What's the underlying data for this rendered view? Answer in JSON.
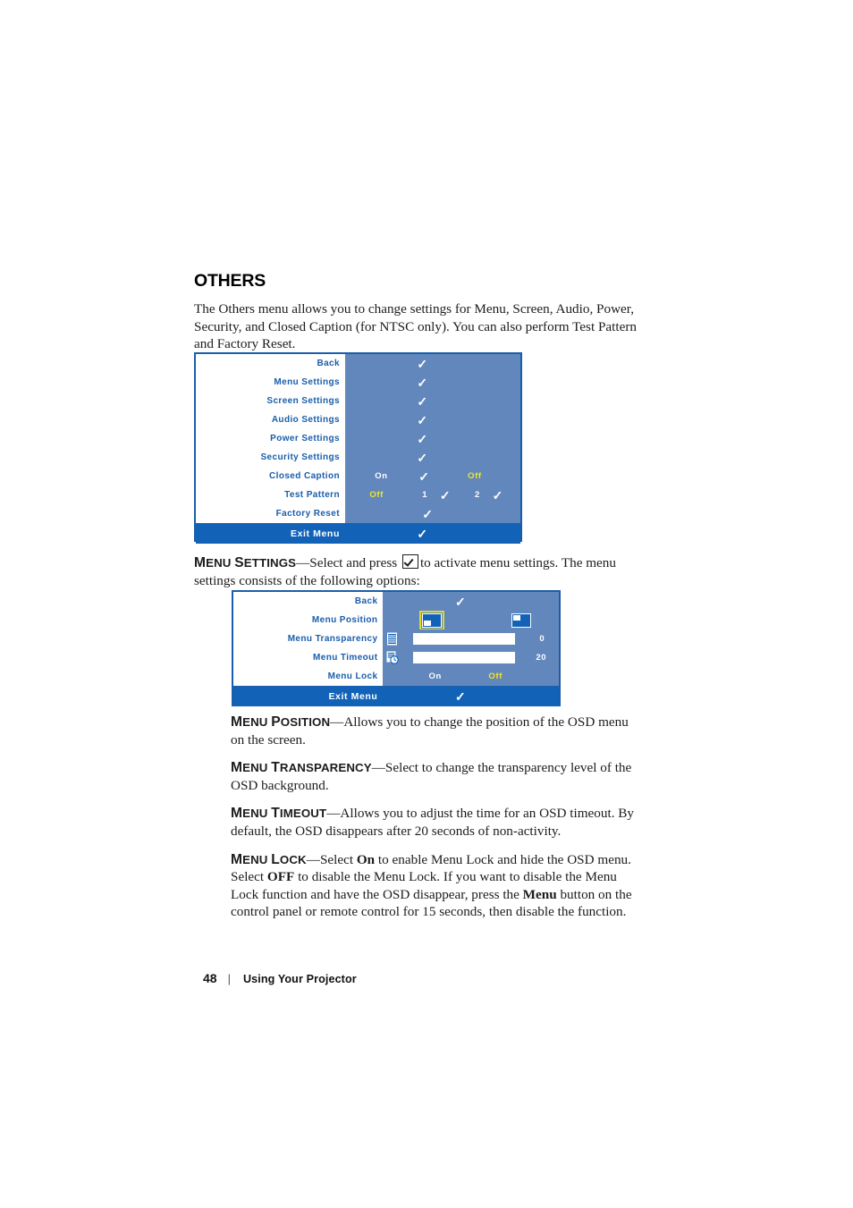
{
  "page": {
    "number": "48",
    "separator": "|",
    "chapter": "Using Your Projector"
  },
  "section": {
    "title": "OTHERS",
    "intro": "The Others menu allows you to change settings for Menu, Screen, Audio, Power, Security, and Closed Caption (for NTSC only). You can also perform Test Pattern and Factory Reset."
  },
  "osd_others": {
    "rows": [
      {
        "label": "Back",
        "check": "✓"
      },
      {
        "label": "Menu Settings",
        "check": "✓"
      },
      {
        "label": "Screen Settings",
        "check": "✓"
      },
      {
        "label": "Audio Settings",
        "check": "✓"
      },
      {
        "label": "Power Settings",
        "check": "✓"
      },
      {
        "label": "Security Settings",
        "check": "✓"
      },
      {
        "label": "Closed Caption",
        "opt1": "On",
        "opt1_check": "✓",
        "opt2": "Off"
      },
      {
        "label": "Test Pattern",
        "opt1": "Off",
        "opt2": "1",
        "opt2_check": "✓",
        "opt3": "2",
        "opt3_check": "✓"
      },
      {
        "label": "Factory Reset",
        "check": "✓"
      }
    ],
    "exit_label": "Exit Menu",
    "exit_check": "✓",
    "colors": {
      "panel_background": "#6287bc",
      "label_background": "#ffffff",
      "label_text": "#1a5eab",
      "exit_bar": "#1263b8",
      "border": "#1a5eab",
      "selected_option": "#f2e71d"
    }
  },
  "menu_settings_intro": {
    "term": "Menu Settings",
    "term_cap": "M",
    "term_cap2": "S",
    "text_before": "—Select and press",
    "icon": "enter-key-icon",
    "text_after": "to activate menu settings. The menu settings consists of the following options:"
  },
  "osd_menu_settings": {
    "rows": [
      {
        "label": "Back",
        "check": "✓"
      },
      {
        "label": "Menu Position",
        "icon1": "position-bottom-left-icon",
        "icon1_selected": true,
        "icon2": "position-top-left-icon"
      },
      {
        "label": "Menu Transparency",
        "glyph": "transparency-icon",
        "slider_percent": 50,
        "value": "0"
      },
      {
        "label": "Menu Timeout",
        "glyph": "timeout-clock-icon",
        "slider_percent": 50,
        "value": "20"
      },
      {
        "label": "Menu Lock",
        "opt1": "On",
        "opt2": "Off"
      }
    ],
    "exit_label": "Exit Menu",
    "exit_check": "✓"
  },
  "definitions": [
    {
      "term": "Menu Position",
      "body": "—Allows you to change the position of the OSD menu on the screen."
    },
    {
      "term": "Menu Transparency",
      "body": "—Select to change the transparency level of the OSD background."
    },
    {
      "term": "Menu Timeout",
      "body": "—Allows you to adjust the time for an OSD timeout. By default, the OSD disappears after 20 seconds of non-activity."
    }
  ],
  "menu_lock": {
    "term": "Menu Lock",
    "part1": "—Select ",
    "bold1": "On",
    "part2": " to enable Menu Lock and hide the OSD menu. Select ",
    "bold2": "OFF",
    "part3": " to disable the Menu Lock. If you want to disable the Menu Lock function and have the OSD disappear, press the ",
    "bold3": "Menu",
    "part4": " button on the control panel or remote control for 15 seconds, then disable the function."
  }
}
